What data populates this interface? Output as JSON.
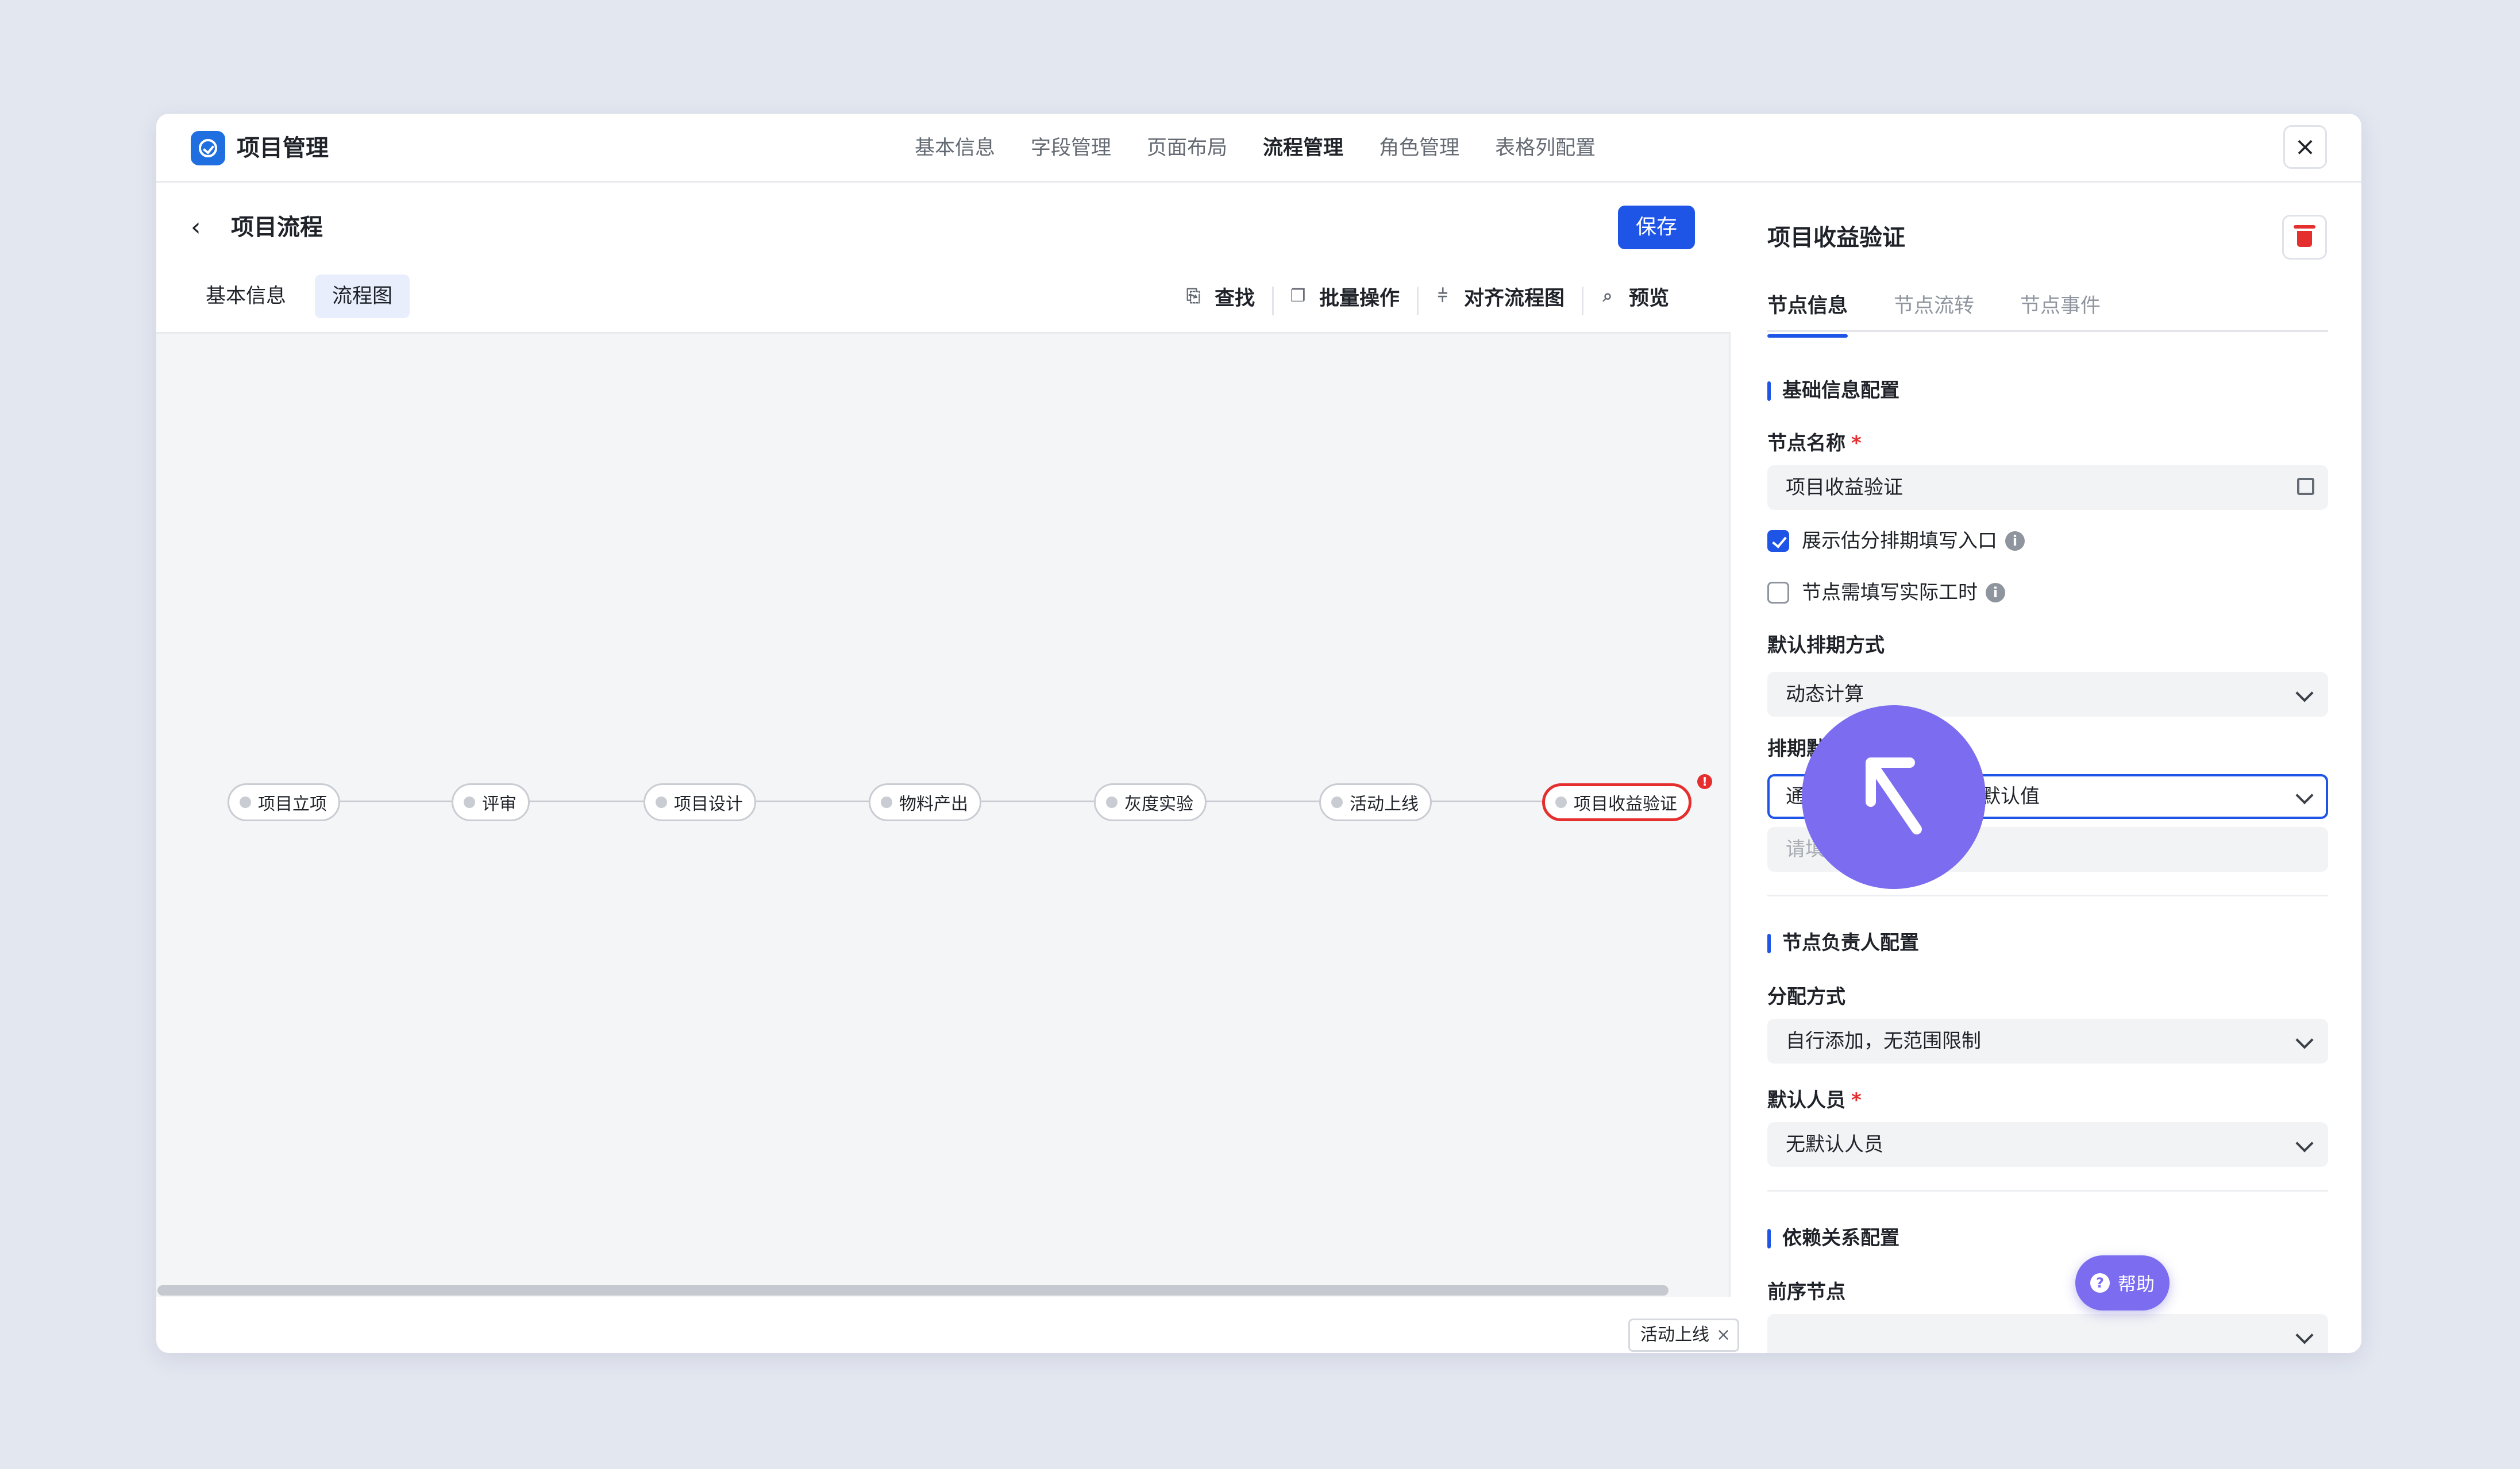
{
  "app": {
    "title": "项目管理",
    "logo_icon": "check-circle-icon"
  },
  "topnav": [
    "基本信息",
    "字段管理",
    "页面布局",
    "流程管理",
    "角色管理",
    "表格列配置"
  ],
  "topnav_active": 3,
  "flow": {
    "title": "项目流程",
    "save_label": "保存",
    "subtabs": [
      "基本信息",
      "流程图"
    ],
    "subtab_active": 1
  },
  "toolbar": [
    {
      "label": "查找",
      "icon": "search-doc-icon"
    },
    {
      "label": "批量操作",
      "icon": "copy-icon"
    },
    {
      "label": "对齐流程图",
      "icon": "align-icon"
    },
    {
      "label": "预览",
      "icon": "preview-icon"
    }
  ],
  "nodes": [
    "项目立项",
    "评审",
    "项目设计",
    "物料产出",
    "灰度实验",
    "活动上线",
    "项目收益验证"
  ],
  "selected_node": 6,
  "node_error_mark": "!",
  "panel": {
    "title": "项目收益验证",
    "tabs": [
      "节点信息",
      "节点流转",
      "节点事件"
    ],
    "tab_active": 0,
    "basic_section": "基础信息配置",
    "node_name_label": "节点名称",
    "required_mark": "*",
    "node_name_value": "项目收益验证",
    "checkbox1": {
      "label": "展示估分排期填写入口",
      "checked": true
    },
    "checkbox2": {
      "label": "节点需填写实际工时",
      "checked": false
    },
    "info_mark": "i",
    "schedule_mode_label": "默认排期方式",
    "schedule_mode_value": "动态计算",
    "schedule_default_label": "排期默认值",
    "schedule_default_value": "通过排期计算规则设置默认值",
    "rule_placeholder": "请填写排期计算规则",
    "owner_section": "节点负责人配置",
    "assign_label": "分配方式",
    "assign_value": "自行添加，无范围限制",
    "default_person_label": "默认人员",
    "default_person_value": "无默认人员",
    "dep_section": "依赖关系配置",
    "pre_node_label": "前序节点",
    "pre_node_tag": "活动上线",
    "tag_close": "×"
  },
  "help": {
    "label": "帮助",
    "mark": "?"
  },
  "colors": {
    "primary": "#1f55e6",
    "danger": "#e52f2f",
    "cursor": "#7b6cf0",
    "bg": "#e3e7f0"
  }
}
